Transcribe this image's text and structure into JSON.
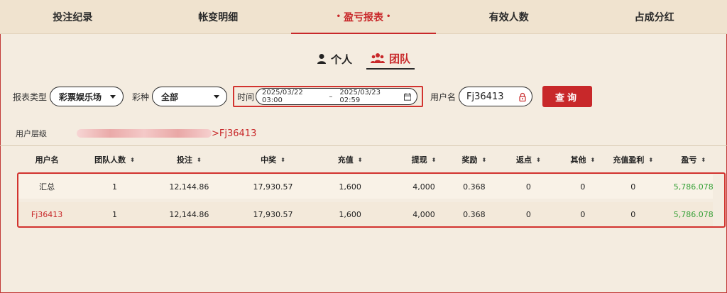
{
  "tabs": [
    {
      "label": "投注纪录"
    },
    {
      "label": "帐变明细"
    },
    {
      "label": "盈亏报表",
      "active": true
    },
    {
      "label": "有效人数"
    },
    {
      "label": "占成分红"
    }
  ],
  "active_tab_dot": "•",
  "switch": {
    "personal": "个人",
    "team": "团队"
  },
  "filters": {
    "report_type_label": "报表类型",
    "report_type_value": "彩票娱乐场",
    "lottery_label": "彩种",
    "lottery_value": "全部",
    "time_label": "时间",
    "date_start": "2025/03/22 03:00",
    "date_sep": "–",
    "date_end": "2025/03/23 02:59",
    "username_label": "用户名",
    "username_value": "Fj36413",
    "query_button": "查询"
  },
  "hierarchy": {
    "label": "用户层级",
    "current": ">Fj36413"
  },
  "table": {
    "headers": [
      "用户名",
      "团队人数",
      "投注",
      "中奖",
      "充值",
      "提现",
      "奖励",
      "返点",
      "其他",
      "充值盈利",
      "盈亏"
    ],
    "sortable": [
      false,
      true,
      true,
      true,
      true,
      true,
      true,
      true,
      true,
      true,
      true
    ],
    "sort_glyph": "⬍",
    "rows": [
      [
        "汇总",
        "1",
        "12,144.86",
        "17,930.57",
        "1,600",
        "4,000",
        "0.368",
        "0",
        "0",
        "0",
        "5,786.078"
      ],
      [
        "Fj36413",
        "1",
        "12,144.86",
        "17,930.57",
        "1,600",
        "4,000",
        "0.368",
        "0",
        "0",
        "0",
        "5,786.078"
      ]
    ]
  },
  "colors": {
    "accent": "#c8282a",
    "profit": "#3aa23a",
    "background": "#f4ece0"
  }
}
